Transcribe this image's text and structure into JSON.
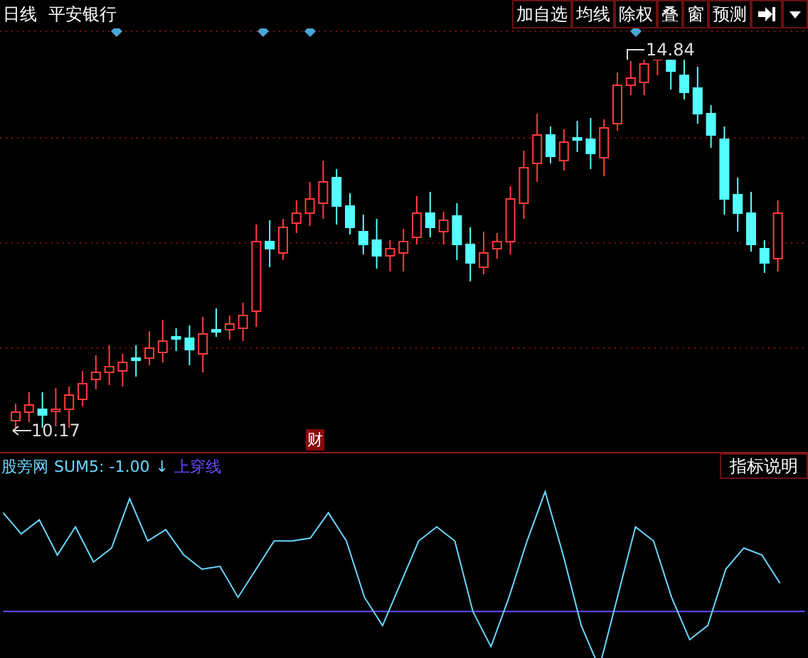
{
  "header": {
    "period": "日线",
    "stock_name": "平安银行"
  },
  "toolbar": [
    "加自选",
    "均线",
    "除权",
    "叠",
    "窗",
    "预测"
  ],
  "price_labels": {
    "high": "14.84",
    "low": "10.17"
  },
  "event_marker": "财",
  "indicator": {
    "name": "股旁网",
    "sum_label": "SUM5: -1.00",
    "sum_arrow": "↓",
    "cross_label": "上穿线"
  },
  "help_button": "指标说明"
}
